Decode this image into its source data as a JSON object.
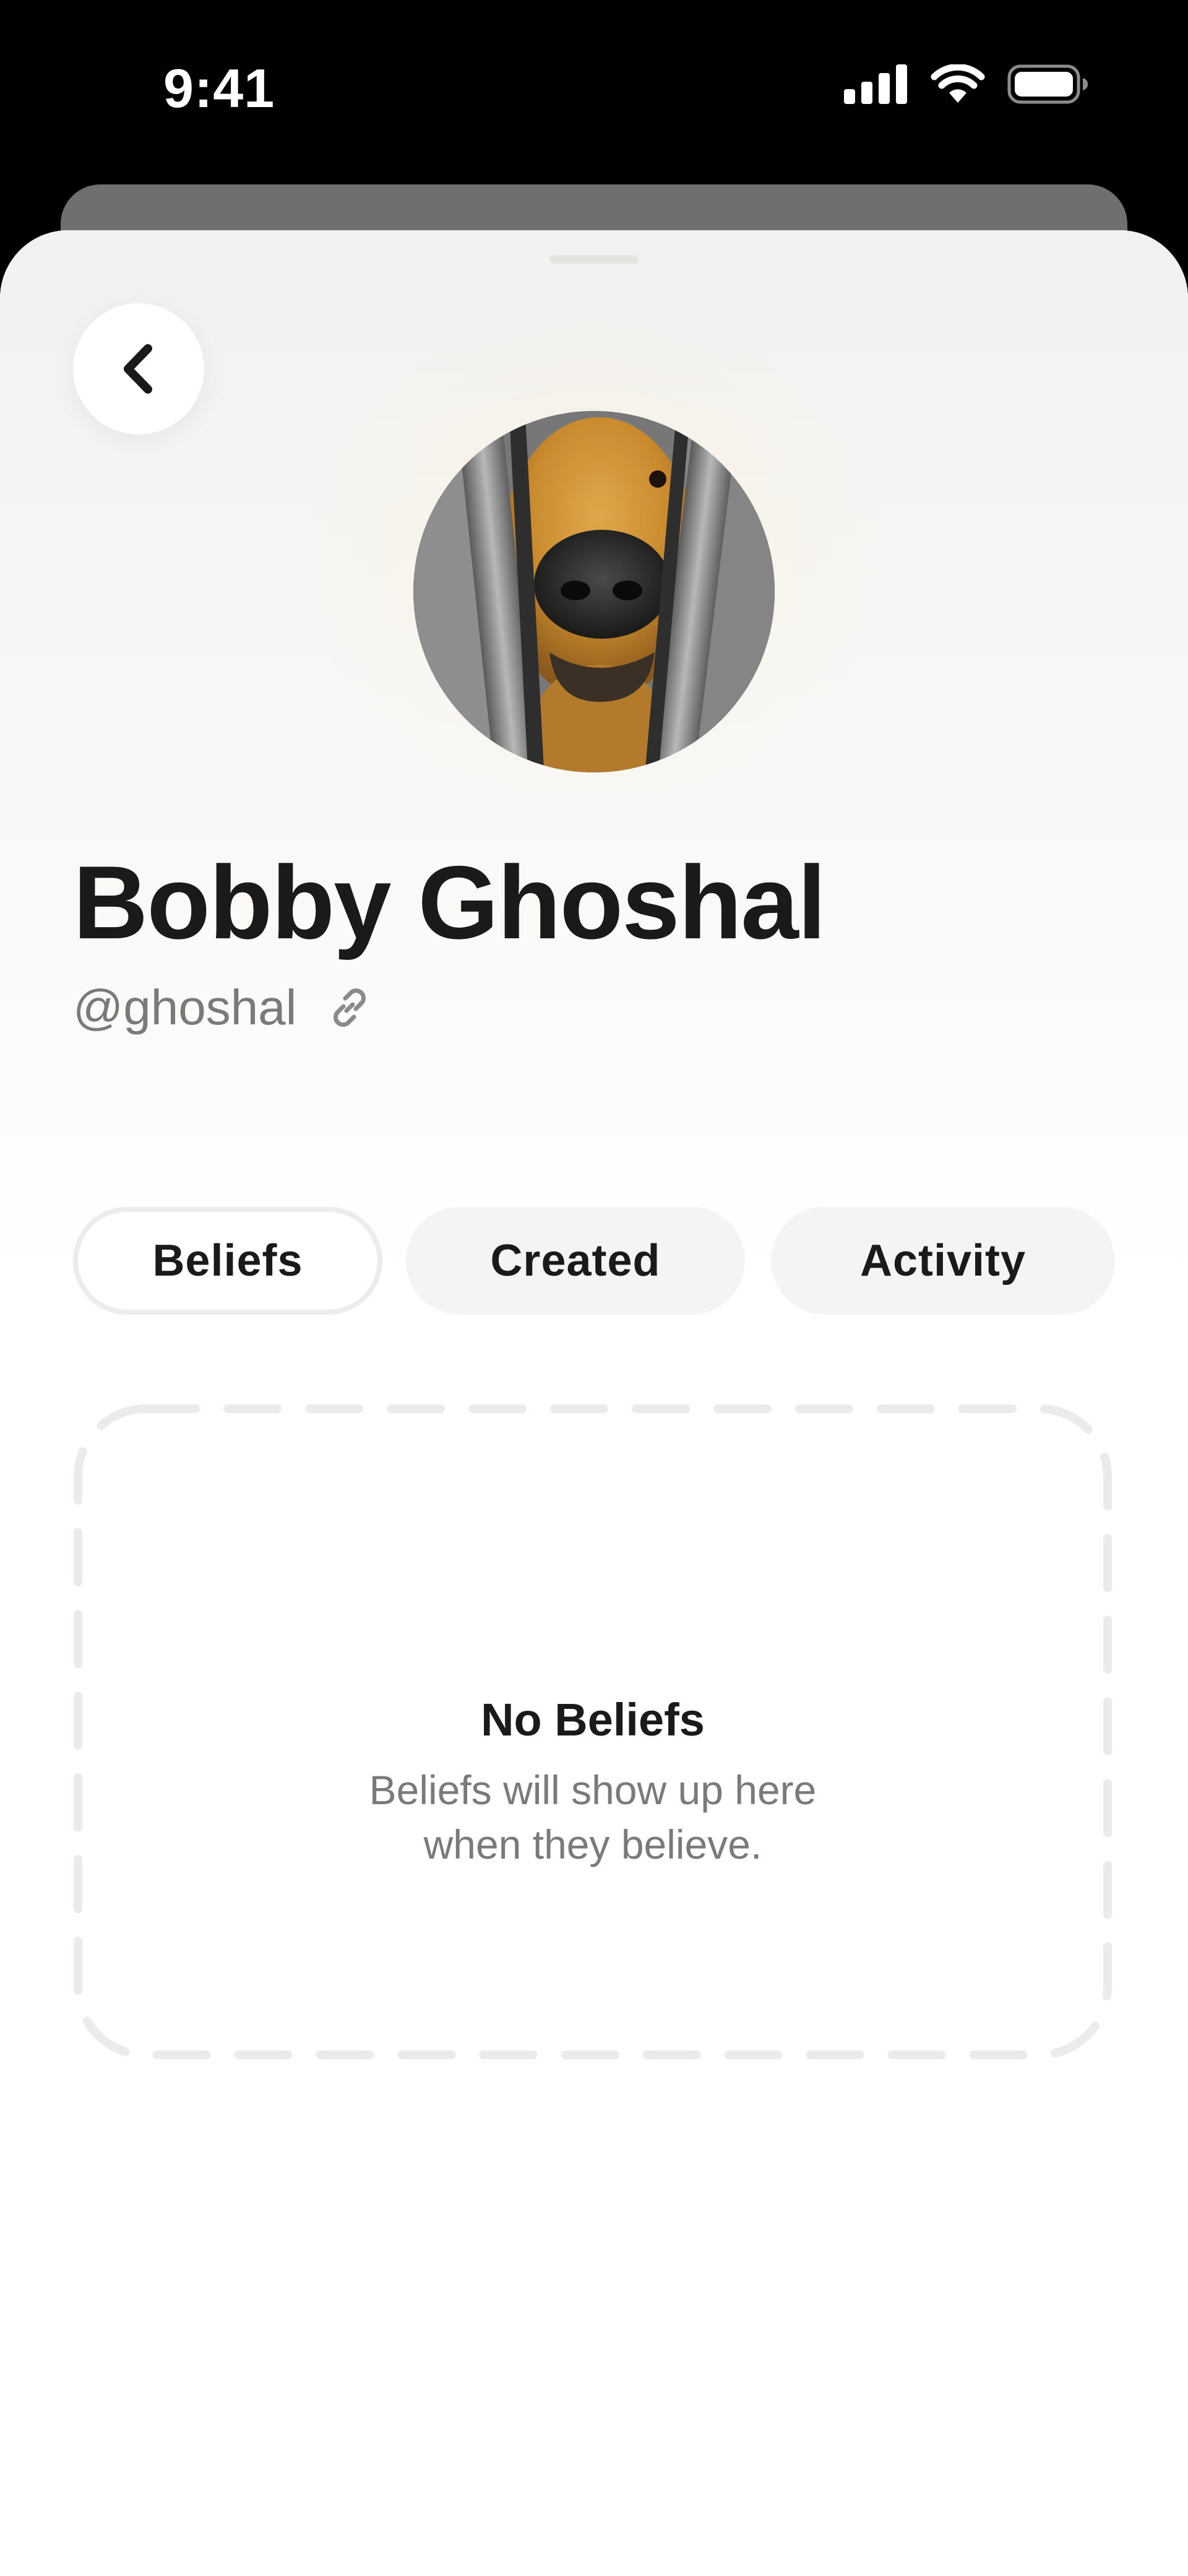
{
  "status_bar": {
    "time": "9:41",
    "icons": [
      "cellular-signal-icon",
      "wifi-icon",
      "battery-icon"
    ]
  },
  "header": {
    "back_icon": "chevron-left-icon"
  },
  "profile": {
    "name": "Bobby Ghoshal",
    "handle": "@ghoshal",
    "link_icon": "link-icon",
    "avatar": "dog-avatar"
  },
  "tabs": [
    {
      "label": "Beliefs",
      "active": true
    },
    {
      "label": "Created",
      "active": false
    },
    {
      "label": "Activity",
      "active": false
    }
  ],
  "empty_state": {
    "title": "No Beliefs",
    "line1": "Beliefs will show up here",
    "line2": "when they believe."
  },
  "colors": {
    "text_primary": "#1a1a1a",
    "text_secondary": "#7a7a7a",
    "tab_inactive_bg": "#f4f4f4",
    "tab_active_border": "#ececec",
    "dashed_border": "#ebebeb"
  }
}
